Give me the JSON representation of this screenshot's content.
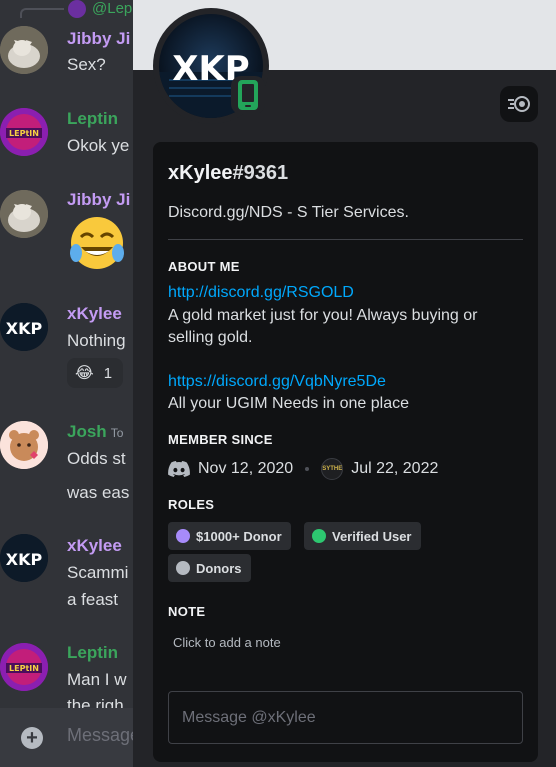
{
  "chat": {
    "reply_mention": "@Lep",
    "messages": [
      {
        "author": "Jibby Ji",
        "author_color": "#c39bf3",
        "lines": [
          "Sex?"
        ]
      },
      {
        "author": "Leptin",
        "author_color": "#3ba55c",
        "lines": [
          "Okok ye"
        ]
      },
      {
        "author": "Jibby Ji",
        "author_color": "#c39bf3",
        "lines": []
      },
      {
        "author": "xKylee",
        "author_color": "#c39bf3",
        "lines": [
          "Nothing"
        ],
        "reaction_count": "1"
      },
      {
        "author": "Josh",
        "author_color": "#3ba55c",
        "timestamp": "To",
        "lines": [
          "Odds st",
          "was eas"
        ]
      },
      {
        "author": "xKylee",
        "author_color": "#c39bf3",
        "lines": [
          "Scammi",
          "a feast"
        ]
      },
      {
        "author": "Leptin",
        "author_color": "#3ba55c",
        "lines": [
          "Man I w",
          "the righ"
        ]
      }
    ],
    "input_placeholder": "Message"
  },
  "profile": {
    "avatar_text": "XKP",
    "username": "xKylee",
    "discriminator": "#9361",
    "custom_status": "Discord.gg/NDS - S Tier Services.",
    "about_title": "ABOUT ME",
    "about": {
      "link1": "http://discord.gg/RSGOLD",
      "line2": "A gold market just for you! Always buying or",
      "line3": "selling gold.",
      "link2": "https://discord.gg/VqbNyre5De",
      "line5": "All your UGIM Needs in one place"
    },
    "member_since_title": "MEMBER SINCE",
    "discord_since": "Nov 12, 2020",
    "server_icon_text": "SYTHE",
    "server_since": "Jul 22, 2022",
    "roles_title": "ROLES",
    "roles": [
      {
        "name": "$1000+ Donor",
        "color": "#a78bfa"
      },
      {
        "name": "Verified User",
        "color": "#2dc770"
      },
      {
        "name": "Donors",
        "color": "#b5bac1"
      }
    ],
    "note_title": "NOTE",
    "note_placeholder": "Click to add a note",
    "message_placeholder": "Message @xKylee"
  },
  "icons": {
    "mobile_status": "mobile-phone-icon",
    "nitro": "nitro-icon",
    "discord": "discord-icon",
    "add": "add-circle-icon"
  },
  "colors": {
    "link": "#00a8fc",
    "mobile_online": "#23a55a"
  }
}
